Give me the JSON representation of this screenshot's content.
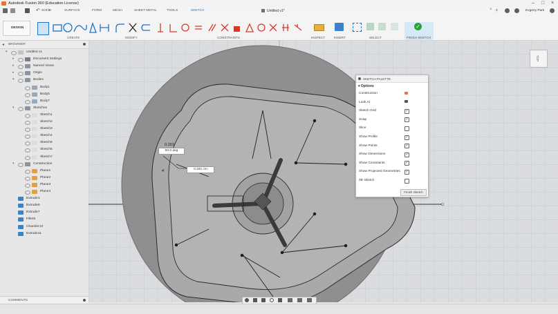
{
  "window": {
    "title": "Autodesk Fusion 360 (Education License)",
    "doc_tab": "Untitled v1*",
    "user": "Evgeny Park"
  },
  "tabs": [
    "SOLID",
    "SURFACE",
    "FORM",
    "MESH",
    "SHEET METAL",
    "TOOLS",
    "SKETCH"
  ],
  "active_tab": "SKETCH",
  "ribbon": {
    "design_label": "DESIGN",
    "groups": [
      "CREATE",
      "MODIFY",
      "CONSTRAINTS",
      "INSPECT",
      "INSERT",
      "SELECT"
    ],
    "finish_label": "FINISH SKETCH"
  },
  "browser": {
    "title": "BROWSER",
    "rows": [
      {
        "label": "Untitled v1",
        "level": 0,
        "icon": "doc"
      },
      {
        "label": "Document Settings",
        "level": 1,
        "icon": "gear"
      },
      {
        "label": "Named Views",
        "level": 1,
        "icon": "folder"
      },
      {
        "label": "Origin",
        "level": 1,
        "icon": "folder"
      },
      {
        "label": "Bodies",
        "level": 1,
        "icon": "folder"
      },
      {
        "label": "Body1",
        "level": 2,
        "icon": "body"
      },
      {
        "label": "Body5",
        "level": 2,
        "icon": "body"
      },
      {
        "label": "Body7",
        "level": 2,
        "icon": "body"
      },
      {
        "label": "Sketches",
        "level": 1,
        "icon": "folder"
      },
      {
        "label": "Sketch1",
        "level": 2,
        "icon": "sketch"
      },
      {
        "label": "Sketch2",
        "level": 2,
        "icon": "sketch"
      },
      {
        "label": "Sketch3",
        "level": 2,
        "icon": "sketch"
      },
      {
        "label": "Sketch4",
        "level": 2,
        "icon": "sketch"
      },
      {
        "label": "Sketch5",
        "level": 2,
        "icon": "sketch"
      },
      {
        "label": "Sketch6",
        "level": 2,
        "icon": "sketch"
      },
      {
        "label": "Sketch7",
        "level": 2,
        "icon": "sketch"
      },
      {
        "label": "Construction",
        "level": 1,
        "icon": "folder"
      },
      {
        "label": "Plane1",
        "level": 2,
        "icon": "plane"
      },
      {
        "label": "Plane2",
        "level": 2,
        "icon": "plane"
      },
      {
        "label": "Plane3",
        "level": 2,
        "icon": "plane"
      },
      {
        "label": "Plane4",
        "level": 2,
        "icon": "plane"
      },
      {
        "label": "Extrude1",
        "level": 0,
        "icon": "feature"
      },
      {
        "label": "Extrude6",
        "level": 0,
        "icon": "feature"
      },
      {
        "label": "Extrude7",
        "level": 0,
        "icon": "feature"
      },
      {
        "label": "Fillet9",
        "level": 0,
        "icon": "feature"
      },
      {
        "label": "Chamfer10",
        "level": 0,
        "icon": "feature"
      },
      {
        "label": "Extrude11",
        "level": 0,
        "icon": "feature"
      }
    ]
  },
  "viewcube": {
    "label": "TOP"
  },
  "dimensions": {
    "angle_value": "60.0 deg",
    "length_value": "0.181 cm",
    "dim_a": "0.153",
    "dim_b": "4"
  },
  "palette": {
    "title": "SKETCH PALETTE",
    "section": "Options",
    "options": [
      {
        "label": "Construction",
        "control": "icon"
      },
      {
        "label": "Look At",
        "control": "icon"
      },
      {
        "label": "Sketch Grid",
        "checked": true
      },
      {
        "label": "Snap",
        "checked": true
      },
      {
        "label": "Slice",
        "checked": false
      },
      {
        "label": "Show Profile",
        "checked": true
      },
      {
        "label": "Show Points",
        "checked": true
      },
      {
        "label": "Show Dimensions",
        "checked": true
      },
      {
        "label": "Show Constraints",
        "checked": true
      },
      {
        "label": "Show Projected Geometries",
        "checked": true
      },
      {
        "label": "3D Sketch",
        "checked": false
      }
    ],
    "finish_button": "Finish Sketch"
  },
  "comments": {
    "label": "COMMENTS"
  },
  "colors": {
    "accent": "#1b72c7",
    "finish": "#27a534",
    "body": "#9a9a9a",
    "body_dark": "#6c6c6c",
    "canvas": "#dadcdf"
  }
}
